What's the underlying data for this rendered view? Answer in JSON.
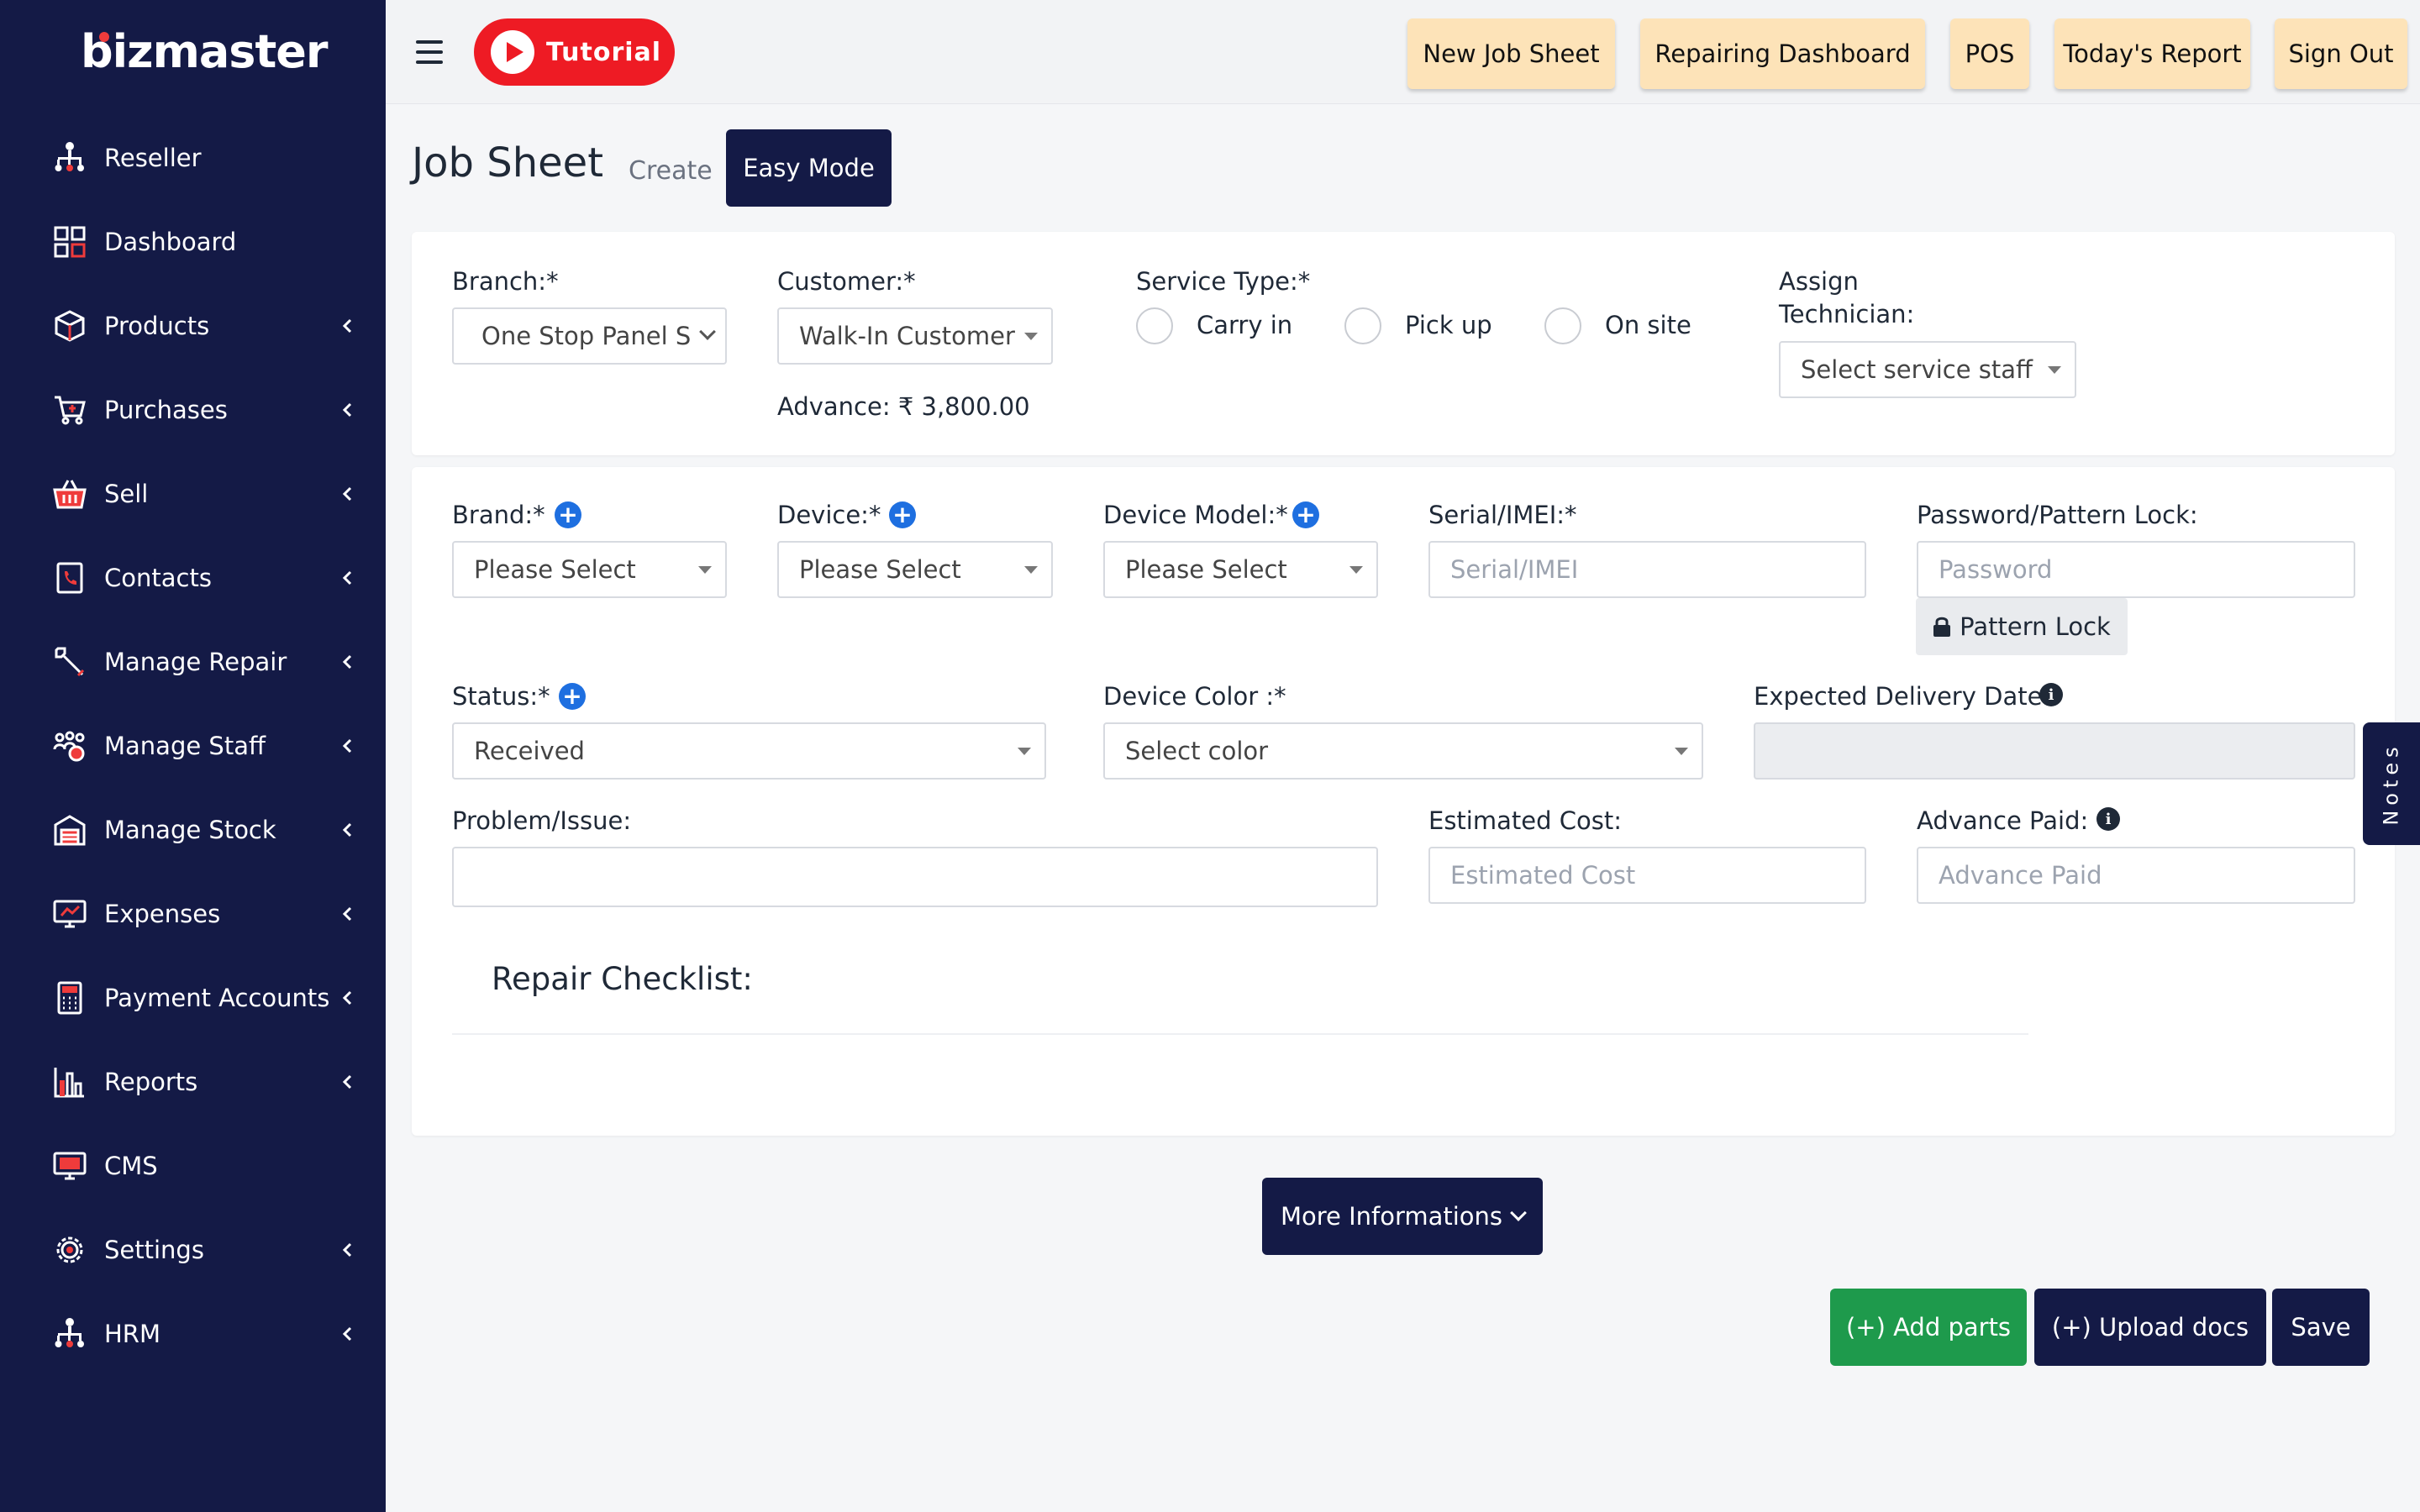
{
  "brand": {
    "name": "bizmaster"
  },
  "sidebar": {
    "items": [
      {
        "label": "Reseller",
        "icon": "hierarchy-icon",
        "chevron": false
      },
      {
        "label": "Dashboard",
        "icon": "dashboard-grid-icon",
        "chevron": false
      },
      {
        "label": "Products",
        "icon": "box-icon",
        "chevron": true
      },
      {
        "label": "Purchases",
        "icon": "cart-icon",
        "chevron": true
      },
      {
        "label": "Sell",
        "icon": "basket-icon",
        "chevron": true
      },
      {
        "label": "Contacts",
        "icon": "phone-book-icon",
        "chevron": true
      },
      {
        "label": "Manage Repair",
        "icon": "wrench-icon",
        "chevron": true
      },
      {
        "label": "Manage Staff",
        "icon": "staff-group-icon",
        "chevron": true
      },
      {
        "label": "Manage Stock",
        "icon": "warehouse-icon",
        "chevron": true
      },
      {
        "label": "Expenses",
        "icon": "expense-screen-icon",
        "chevron": true
      },
      {
        "label": "Payment Accounts",
        "icon": "calculator-icon",
        "chevron": true
      },
      {
        "label": "Reports",
        "icon": "bar-report-icon",
        "chevron": true
      },
      {
        "label": "CMS",
        "icon": "monitor-icon",
        "chevron": false
      },
      {
        "label": "Settings",
        "icon": "gear-icon",
        "chevron": true
      },
      {
        "label": "HRM",
        "icon": "hierarchy-icon",
        "chevron": true
      }
    ]
  },
  "topbar": {
    "tutorial_label": "Tutorial",
    "buttons": [
      "New Job Sheet",
      "Repairing Dashboard",
      "POS",
      "Today's Report",
      "Sign Out"
    ]
  },
  "page": {
    "title": "Job Sheet",
    "subtitle": "Create",
    "easy_mode_label": "Easy Mode"
  },
  "form": {
    "branch": {
      "label": "Branch:*",
      "value": "One Stop Panel S"
    },
    "customer": {
      "label": "Customer:*",
      "value": "Walk-In Customer",
      "advance": "Advance: ₹ 3,800.00"
    },
    "service_type": {
      "label": "Service Type:*",
      "options": [
        "Carry in",
        "Pick up",
        "On site"
      ]
    },
    "technician": {
      "label_line1": "Assign",
      "label_line2": "Technician:",
      "value": "Select service staff"
    },
    "brand": {
      "label": "Brand:*",
      "value": "Please Select"
    },
    "device": {
      "label": "Device:*",
      "value": "Please Select"
    },
    "device_model": {
      "label": "Device Model:*",
      "value": "Please Select"
    },
    "serial": {
      "label": "Serial/IMEI:*",
      "placeholder": "Serial/IMEI"
    },
    "password": {
      "label": "Password/Pattern Lock:",
      "placeholder": "Password",
      "pattern_label": "Pattern Lock"
    },
    "status": {
      "label": "Status:*",
      "value": "Received"
    },
    "device_color": {
      "label": "Device Color :*",
      "value": "Select color"
    },
    "delivery_date": {
      "label": "Expected Delivery Date:"
    },
    "problem": {
      "label": "Problem/Issue:"
    },
    "estimated_cost": {
      "label": "Estimated Cost:",
      "placeholder": "Estimated Cost"
    },
    "advance_paid": {
      "label": "Advance Paid:",
      "placeholder": "Advance Paid"
    },
    "checklist_title": "Repair Checklist:"
  },
  "notes_label": "Notes",
  "actions": {
    "more_label": "More Informations",
    "add_parts": "(+) Add parts",
    "upload_docs": "(+) Upload docs",
    "save": "Save"
  },
  "colors": {
    "sidebar_bg": "#141a46",
    "topbtn_bg": "#fde3b8",
    "tutorial_red": "#ee1b24",
    "add_parts_green": "#1e9a4c",
    "plus_blue": "#1e6fe0"
  }
}
